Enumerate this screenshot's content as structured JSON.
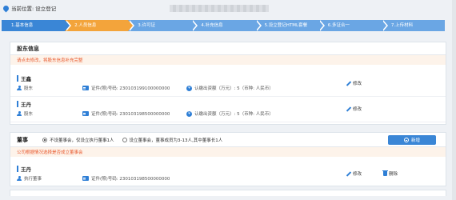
{
  "location": {
    "label": "当前位置: 设立登记"
  },
  "steps": [
    {
      "label": "1.基本信息",
      "state": "done"
    },
    {
      "label": "2.人员信息",
      "state": "active"
    },
    {
      "label": "3.许可证",
      "state": "future"
    },
    {
      "label": "4.补充信息",
      "state": "future"
    },
    {
      "label": "5.设立登记HTML套餐",
      "state": "future"
    },
    {
      "label": "6.多证合一",
      "state": "future"
    },
    {
      "label": "7.上传材料",
      "state": "future"
    }
  ],
  "shareholders": {
    "title": "股东信息",
    "warning": "请点击修改，将股东信息补充完整",
    "items": [
      {
        "name": "王鑫",
        "role": "股东",
        "id_text": "证件(照)号码: 230103199100000000",
        "capital_text": "认缴出资额（万元）: 5（币种: 人民币）",
        "edit_label": "修改"
      },
      {
        "name": "王丹",
        "role": "股东",
        "id_text": "证件(照)号码: 230103198500000000",
        "capital_text": "认缴出资额（万元）: 5（币种: 人民币）",
        "edit_label": "修改"
      }
    ]
  },
  "directors": {
    "title": "董事",
    "option_a": "不设董事会，仅设立执行董事1人",
    "option_b": "设立董事会，董事成员为3-13人,其中董事长1人",
    "add_label": "新增",
    "warning": "公司根据情况选择是否成立董事会",
    "items": [
      {
        "name": "王丹",
        "role": "执行董事",
        "id_text": "证件(照)号码: 230103198500000000",
        "edit_label": "修改",
        "delete_label": "删除"
      }
    ]
  },
  "colors": {
    "primary": "#3a86d6",
    "active_step": "#f3a43b",
    "warning": "#e8582c"
  }
}
